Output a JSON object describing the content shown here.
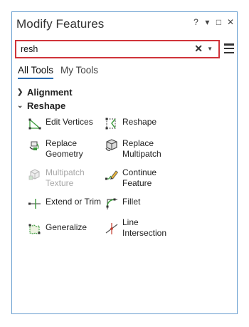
{
  "pane": {
    "title": "Modify Features",
    "buttons": {
      "help": "?",
      "menu": "▾",
      "maximize": "□",
      "close": "✕"
    }
  },
  "search": {
    "value": "resh",
    "placeholder": ""
  },
  "tabs": [
    {
      "label": "All Tools",
      "active": true
    },
    {
      "label": "My Tools",
      "active": false
    }
  ],
  "groups": [
    {
      "label": "Alignment",
      "expanded": false
    },
    {
      "label": "Reshape",
      "expanded": true
    }
  ],
  "tools": {
    "edit_vertices": "Edit Vertices",
    "reshape": "Reshape",
    "replace_geometry": "Replace\nGeometry",
    "replace_multipatch": "Replace\nMultipatch",
    "multipatch_texture": "Multipatch\nTexture",
    "continue_feature": "Continue\nFeature",
    "extend_or_trim": "Extend or Trim",
    "fillet": "Fillet",
    "generalize": "Generalize",
    "line_intersection": "Line\nIntersection"
  },
  "colors": {
    "highlight_border": "#d0343a",
    "pane_border": "#6a9fd0",
    "tab_underline": "#2a6cb2"
  }
}
